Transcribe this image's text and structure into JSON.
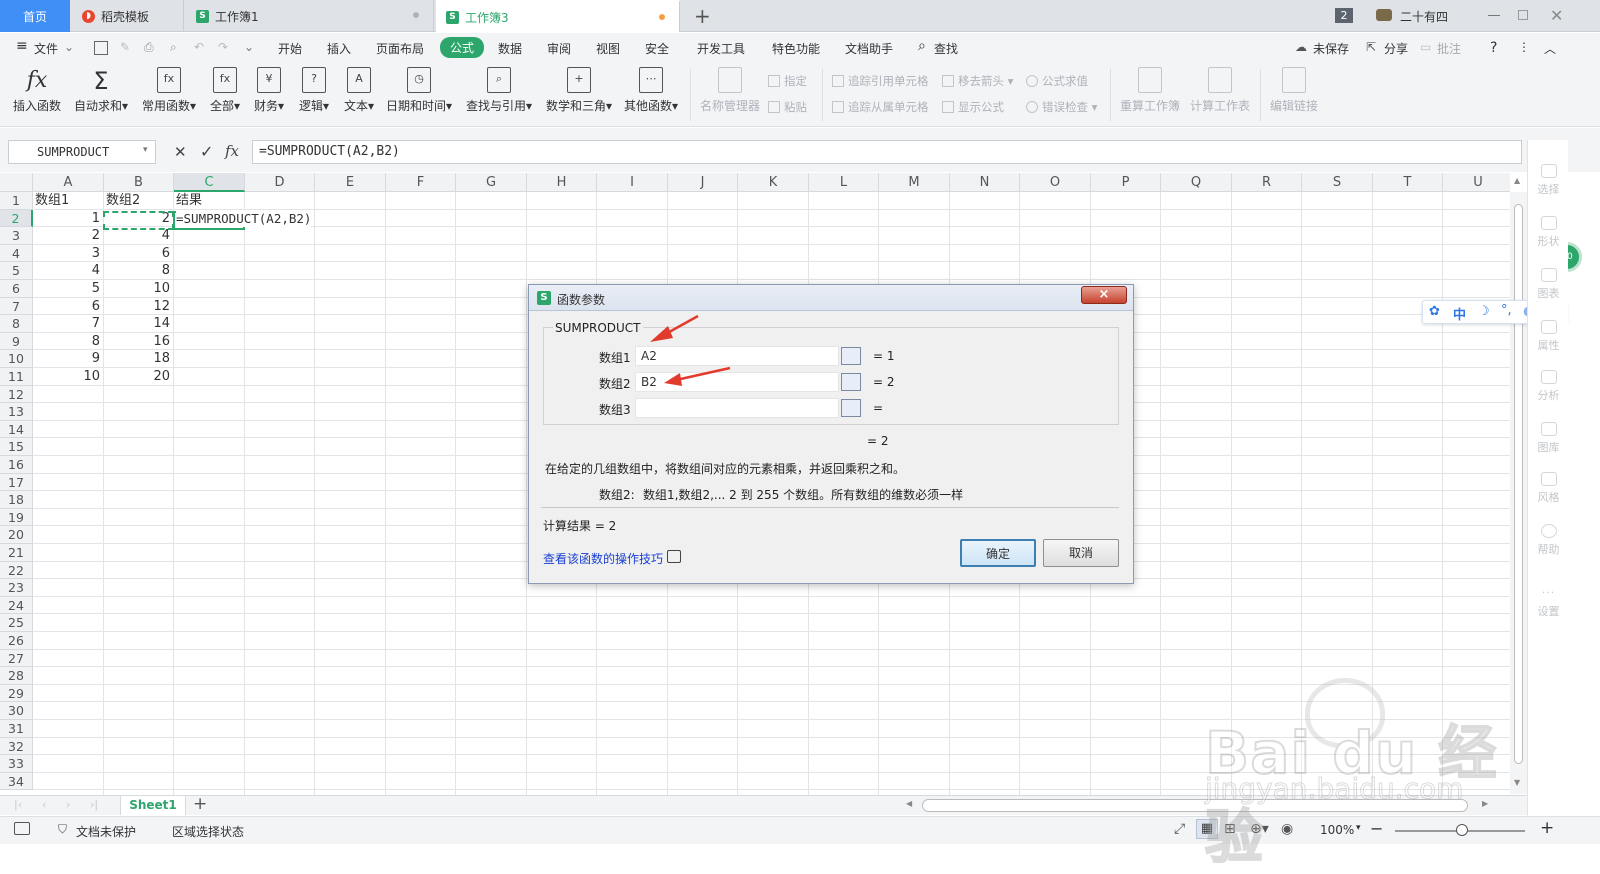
{
  "tabs": {
    "home": "首页",
    "template": "稻壳模板",
    "book1": "工作簿1",
    "book3": "工作簿3",
    "new_tab": "+",
    "window_count": "2",
    "user": "二十有四"
  },
  "menu": {
    "file": "文件",
    "items": [
      "开始",
      "插入",
      "页面布局",
      "公式",
      "数据",
      "审阅",
      "视图",
      "安全",
      "开发工具",
      "特色功能",
      "文档助手",
      "查找"
    ],
    "active": "公式",
    "unsaved": "未保存",
    "share": "分享",
    "comment": "批注",
    "help": "?"
  },
  "ribbon": {
    "big": [
      "插入函数",
      "自动求和",
      "常用函数",
      "全部",
      "财务",
      "逻辑",
      "文本",
      "日期和时间",
      "查找与引用",
      "数学和三角",
      "其他函数",
      "名称管理器"
    ],
    "small": [
      "指定",
      "粘贴",
      "追踪引用单元格",
      "追踪从属单元格",
      "移去箭头",
      "显示公式",
      "公式求值",
      "错误检查"
    ],
    "big2": [
      "重算工作簿",
      "计算工作表",
      "编辑链接"
    ]
  },
  "formula_bar": {
    "name_box": "SUMPRODUCT",
    "formula": "=SUMPRODUCT(A2,B2)"
  },
  "sheet": {
    "columns": [
      "A",
      "B",
      "C",
      "D",
      "E",
      "F",
      "G",
      "H",
      "I",
      "J",
      "K",
      "L",
      "M",
      "N",
      "O",
      "P",
      "Q",
      "R",
      "S",
      "T",
      "U"
    ],
    "headers": [
      "数组1",
      "数组2",
      "结果"
    ],
    "col_a": [
      "1",
      "2",
      "3",
      "4",
      "5",
      "6",
      "7",
      "8",
      "9",
      "10"
    ],
    "col_b": [
      "2",
      "4",
      "6",
      "8",
      "10",
      "12",
      "14",
      "16",
      "18",
      "20"
    ],
    "c2": "=SUMPRODUCT(A2,B2)",
    "row_count": 34,
    "sheet_tab": "Sheet1"
  },
  "dialog": {
    "title": "函数参数",
    "close": "×",
    "func_name": "SUMPRODUCT",
    "args": [
      {
        "label": "数组1",
        "value": "A2",
        "result": "=  1"
      },
      {
        "label": "数组2",
        "value": "B2",
        "result": "=  2"
      },
      {
        "label": "数组3",
        "value": "",
        "result": "="
      }
    ],
    "overall": "=  2",
    "description": "在给定的几组数组中，将数组间对应的元素相乘，并返回乘积之和。",
    "arg_help_label": "数组2:",
    "arg_help": "数组1,数组2,... 2 到 255 个数组。所有数组的维数必须一样",
    "calc_result": "计算结果  =  2",
    "tips_link": "查看该函数的操作技巧",
    "ok": "确定",
    "cancel": "取消"
  },
  "right_panel": [
    "选择",
    "形状",
    "图表",
    "属性",
    "分析",
    "图库",
    "风格",
    "帮助",
    "设置"
  ],
  "ime": [
    "中"
  ],
  "status": {
    "doc_protect": "文档未保护",
    "region": "区域选择状态",
    "zoom": "100%",
    "zoom_minus": "−",
    "zoom_plus": "+"
  },
  "watermark": {
    "brand": "Bai du 经验",
    "url": "jingyan.baidu.com"
  },
  "colors": {
    "accent_green": "#2da66b",
    "tab_active_bg": "#ffffff",
    "link_blue": "#1a3fd1",
    "arrow_red": "#e23b2e"
  }
}
